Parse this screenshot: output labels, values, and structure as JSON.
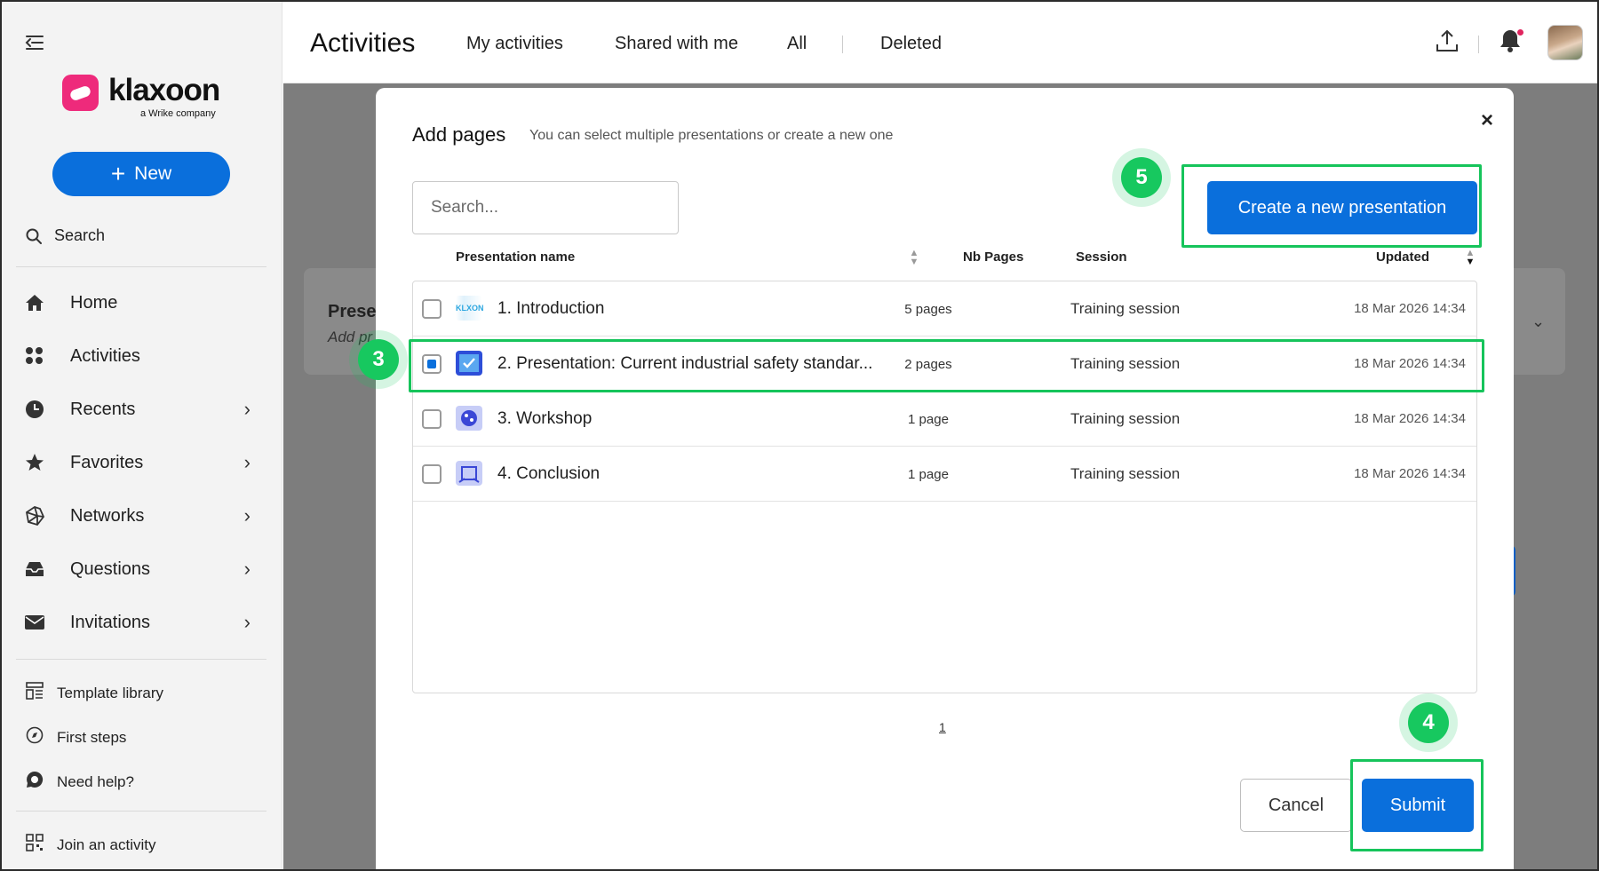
{
  "app": {
    "logo_text": "klaxoon",
    "logo_subtext": "a Wrike company"
  },
  "sidebar": {
    "new_button_label": "New",
    "search_label": "Search",
    "nav_items": [
      {
        "label": "Home",
        "icon": "home-icon",
        "has_submenu": false
      },
      {
        "label": "Activities",
        "icon": "activities-grid-icon",
        "has_submenu": false
      },
      {
        "label": "Recents",
        "icon": "clock-icon",
        "has_submenu": true
      },
      {
        "label": "Favorites",
        "icon": "star-icon",
        "has_submenu": true
      },
      {
        "label": "Networks",
        "icon": "network-icon",
        "has_submenu": true
      },
      {
        "label": "Questions",
        "icon": "inbox-icon",
        "has_submenu": true
      },
      {
        "label": "Invitations",
        "icon": "envelope-icon",
        "has_submenu": true
      }
    ],
    "util_items": [
      {
        "label": "Template library",
        "icon": "template-icon"
      },
      {
        "label": "First steps",
        "icon": "compass-icon"
      },
      {
        "label": "Need help?",
        "icon": "help-chat-icon"
      }
    ],
    "join_label": "Join an activity"
  },
  "header": {
    "title": "Activities",
    "tabs": [
      "My activities",
      "Shared with me",
      "All",
      "Deleted"
    ],
    "icons": [
      "export-icon",
      "bell-icon",
      "avatar"
    ]
  },
  "background": {
    "section_title": "Prese",
    "section_subtitle": "Add pr"
  },
  "modal": {
    "title": "Add pages",
    "subtitle": "You can select multiple presentations or create a new one",
    "close_label": "×",
    "search_placeholder": "Search...",
    "create_button_label": "Create a new presentation",
    "columns": {
      "name": "Presentation name",
      "pages": "Nb Pages",
      "session": "Session",
      "updated": "Updated"
    },
    "rows": [
      {
        "name": "1. Introduction",
        "pages": "5 pages",
        "session": "Training session",
        "updated": "18 Mar 2026 14:34",
        "checked": false
      },
      {
        "name": "2. Presentation: Current industrial safety standar...",
        "pages": "2 pages",
        "session": "Training session",
        "updated": "18 Mar 2026 14:34",
        "checked": true
      },
      {
        "name": "3. Workshop",
        "pages": "1 page",
        "session": "Training session",
        "updated": "18 Mar 2026 14:34",
        "checked": false
      },
      {
        "name": "4. Conclusion",
        "pages": "1 page",
        "session": "Training session",
        "updated": "18 Mar 2026 14:34",
        "checked": false
      }
    ],
    "pagination": "1",
    "cancel_label": "Cancel",
    "submit_label": "Submit"
  },
  "annotations": {
    "step_row": "3",
    "step_submit": "4",
    "step_create": "5",
    "highlight_color": "#16c45b"
  },
  "colors": {
    "primary": "#0a6fdc",
    "brand_pink": "#ee2a7b",
    "annotation_green": "#17c85f"
  }
}
